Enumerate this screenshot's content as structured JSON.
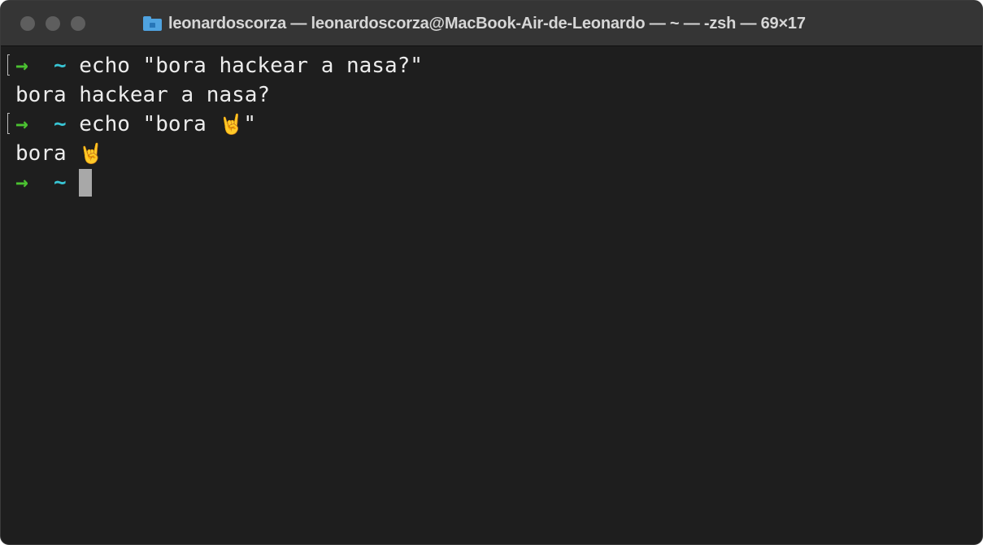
{
  "window": {
    "title": "leonardoscorza — leonardoscorza@MacBook-Air-de-Leonardo — ~ — -zsh — 69×17",
    "folder_icon": "folder-icon"
  },
  "prompt": {
    "arrow": "→",
    "cwd": "~"
  },
  "terminal": {
    "line1_command": "echo \"bora hackear a nasa?\"",
    "line2_output": "bora hackear a nasa?",
    "line3_command_prefix": "echo \"bora ",
    "line3_emoji": "🤘",
    "line3_command_suffix": "\"",
    "line4_output_prefix": "bora ",
    "line4_emoji": "🤘"
  },
  "colors": {
    "background": "#1e1e1e",
    "titlebar": "#353535",
    "prompt_arrow": "#4bc231",
    "prompt_tilde": "#38c5d4",
    "text": "#ececec",
    "cursor": "#a8a8a8"
  }
}
